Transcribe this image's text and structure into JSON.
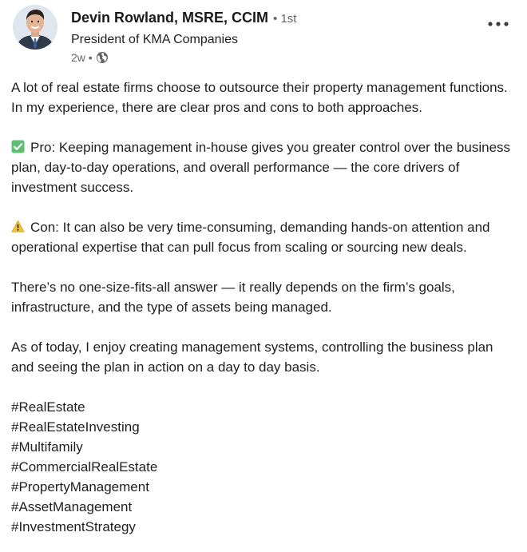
{
  "author": {
    "name": "Devin Rowland, MSRE, CCIM",
    "degree": "• 1st",
    "headline": "President of KMA Companies",
    "timestamp": "2w •",
    "visibility_icon": "globe-icon"
  },
  "menu": {
    "more_label": "•••"
  },
  "post": {
    "intro": "A lot of real estate firms choose to outsource their property management functions. In my experience, there are clear pros and cons to both approaches.",
    "pro": "Pro: Keeping management in-house gives you greater control over the business plan, day-to-day operations, and overall performance — the core drivers of investment success.",
    "con": "Con: It can also be very time-consuming, demanding hands-on attention and operational expertise that can pull focus from scaling or sourcing new deals.",
    "answer": "There’s no one-size-fits-all answer — it really depends on the firm’s goals, infrastructure, and the type of assets being managed.",
    "today": "As of today, I enjoy creating management systems, controlling the business plan and seeing the plan in action on a day to day basis.",
    "hashtags": [
      "#RealEstate",
      "#RealEstateInvesting",
      "#Multifamily",
      "#CommercialRealEstate",
      "#PropertyManagement",
      "#AssetManagement",
      "#InvestmentStrategy"
    ]
  },
  "colors": {
    "check_green": "#5fbf71",
    "warning_yellow": "#f2c233",
    "muted_text": "#666666"
  }
}
